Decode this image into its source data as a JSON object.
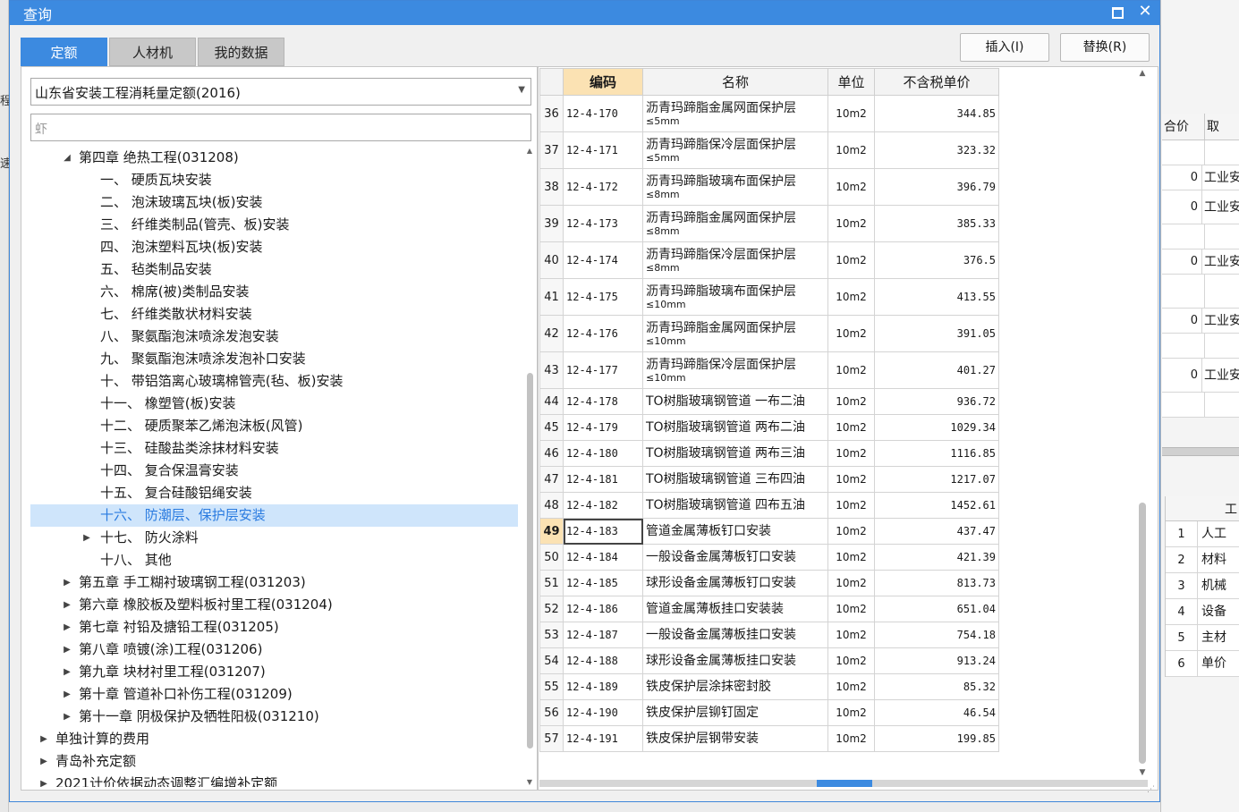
{
  "dialog": {
    "title": "查询"
  },
  "tabs": [
    "定额",
    "人材机",
    "我的数据"
  ],
  "actions": {
    "insert": "插入(I)",
    "replace": "替换(R)"
  },
  "library_select": "山东省安装工程消耗量定额(2016)",
  "search_placeholder": "虾",
  "tree": [
    {
      "label": "第四章 绝热工程(031208)",
      "level": 1,
      "toggle": "down",
      "selected": false
    },
    {
      "label": "一、  硬质瓦块安装",
      "level": 2,
      "toggle": "",
      "selected": false
    },
    {
      "label": "二、  泡沫玻璃瓦块(板)安装",
      "level": 2,
      "toggle": "",
      "selected": false
    },
    {
      "label": "三、  纤维类制品(管壳、板)安装",
      "level": 2,
      "toggle": "",
      "selected": false
    },
    {
      "label": "四、  泡沫塑料瓦块(板)安装",
      "level": 2,
      "toggle": "",
      "selected": false
    },
    {
      "label": "五、  毡类制品安装",
      "level": 2,
      "toggle": "",
      "selected": false
    },
    {
      "label": "六、  棉席(被)类制品安装",
      "level": 2,
      "toggle": "",
      "selected": false
    },
    {
      "label": "七、  纤维类散状材料安装",
      "level": 2,
      "toggle": "",
      "selected": false
    },
    {
      "label": "八、  聚氨酯泡沫喷涂发泡安装",
      "level": 2,
      "toggle": "",
      "selected": false
    },
    {
      "label": "九、  聚氨酯泡沫喷涂发泡补口安装",
      "level": 2,
      "toggle": "",
      "selected": false
    },
    {
      "label": "十、  带铝箔离心玻璃棉管壳(毡、板)安装",
      "level": 2,
      "toggle": "",
      "selected": false
    },
    {
      "label": "十一、  橡塑管(板)安装",
      "level": 2,
      "toggle": "",
      "selected": false
    },
    {
      "label": "十二、  硬质聚苯乙烯泡沫板(风管)",
      "level": 2,
      "toggle": "",
      "selected": false
    },
    {
      "label": "十三、  硅酸盐类涂抹材料安装",
      "level": 2,
      "toggle": "",
      "selected": false
    },
    {
      "label": "十四、  复合保温膏安装",
      "level": 2,
      "toggle": "",
      "selected": false
    },
    {
      "label": "十五、  复合硅酸铝绳安装",
      "level": 2,
      "toggle": "",
      "selected": false
    },
    {
      "label": "十六、  防潮层、保护层安装",
      "level": 2,
      "toggle": "",
      "selected": true
    },
    {
      "label": "十七、  防火涂料",
      "level": 2,
      "toggle": "right",
      "selected": false
    },
    {
      "label": "十八、  其他",
      "level": 2,
      "toggle": "",
      "selected": false
    },
    {
      "label": "第五章 手工糊衬玻璃钢工程(031203)",
      "level": 1,
      "toggle": "right",
      "selected": false
    },
    {
      "label": "第六章 橡胶板及塑料板衬里工程(031204)",
      "level": 1,
      "toggle": "right",
      "selected": false
    },
    {
      "label": "第七章 衬铅及搪铅工程(031205)",
      "level": 1,
      "toggle": "right",
      "selected": false
    },
    {
      "label": "第八章 喷镀(涂)工程(031206)",
      "level": 1,
      "toggle": "right",
      "selected": false
    },
    {
      "label": "第九章 块材衬里工程(031207)",
      "level": 1,
      "toggle": "right",
      "selected": false
    },
    {
      "label": "第十章 管道补口补伤工程(031209)",
      "level": 1,
      "toggle": "right",
      "selected": false
    },
    {
      "label": "第十一章 阴极保护及牺牲阳极(031210)",
      "level": 1,
      "toggle": "right",
      "selected": false
    },
    {
      "label": "单独计算的费用",
      "level": 0,
      "toggle": "right",
      "selected": false
    },
    {
      "label": "青岛补充定额",
      "level": 0,
      "toggle": "right",
      "selected": false
    },
    {
      "label": "2021计价依据动态调整汇编增补定额",
      "level": 0,
      "toggle": "right",
      "selected": false
    }
  ],
  "grid": {
    "headers": [
      "编码",
      "名称",
      "单位",
      "不含税单价"
    ],
    "current_row": "49",
    "rows": [
      {
        "no": "36",
        "code": "12-4-170",
        "name": "沥青玛蹄脂金属网面保护层",
        "sub": "≤5mm",
        "unit": "10m2",
        "price": "344.85"
      },
      {
        "no": "37",
        "code": "12-4-171",
        "name": "沥青玛蹄脂保冷层面保护层",
        "sub": "≤5mm",
        "unit": "10m2",
        "price": "323.32"
      },
      {
        "no": "38",
        "code": "12-4-172",
        "name": "沥青玛蹄脂玻璃布面保护层",
        "sub": "≤8mm",
        "unit": "10m2",
        "price": "396.79"
      },
      {
        "no": "39",
        "code": "12-4-173",
        "name": "沥青玛蹄脂金属网面保护层",
        "sub": "≤8mm",
        "unit": "10m2",
        "price": "385.33"
      },
      {
        "no": "40",
        "code": "12-4-174",
        "name": "沥青玛蹄脂保冷层面保护层",
        "sub": "≤8mm",
        "unit": "10m2",
        "price": "376.5"
      },
      {
        "no": "41",
        "code": "12-4-175",
        "name": "沥青玛蹄脂玻璃布面保护层",
        "sub": "≤10mm",
        "unit": "10m2",
        "price": "413.55"
      },
      {
        "no": "42",
        "code": "12-4-176",
        "name": "沥青玛蹄脂金属网面保护层",
        "sub": "≤10mm",
        "unit": "10m2",
        "price": "391.05"
      },
      {
        "no": "43",
        "code": "12-4-177",
        "name": "沥青玛蹄脂保冷层面保护层",
        "sub": "≤10mm",
        "unit": "10m2",
        "price": "401.27"
      },
      {
        "no": "44",
        "code": "12-4-178",
        "name": "TO树脂玻璃钢管道 一布二油",
        "sub": "",
        "unit": "10m2",
        "price": "936.72"
      },
      {
        "no": "45",
        "code": "12-4-179",
        "name": "TO树脂玻璃钢管道 两布二油",
        "sub": "",
        "unit": "10m2",
        "price": "1029.34"
      },
      {
        "no": "46",
        "code": "12-4-180",
        "name": "TO树脂玻璃钢管道 两布三油",
        "sub": "",
        "unit": "10m2",
        "price": "1116.85"
      },
      {
        "no": "47",
        "code": "12-4-181",
        "name": "TO树脂玻璃钢管道 三布四油",
        "sub": "",
        "unit": "10m2",
        "price": "1217.07"
      },
      {
        "no": "48",
        "code": "12-4-182",
        "name": "TO树脂玻璃钢管道 四布五油",
        "sub": "",
        "unit": "10m2",
        "price": "1452.61"
      },
      {
        "no": "49",
        "code": "12-4-183",
        "name": "管道金属薄板钉口安装",
        "sub": "",
        "unit": "10m2",
        "price": "437.47"
      },
      {
        "no": "50",
        "code": "12-4-184",
        "name": "一般设备金属薄板钉口安装",
        "sub": "",
        "unit": "10m2",
        "price": "421.39"
      },
      {
        "no": "51",
        "code": "12-4-185",
        "name": "球形设备金属薄板钉口安装",
        "sub": "",
        "unit": "10m2",
        "price": "813.73"
      },
      {
        "no": "52",
        "code": "12-4-186",
        "name": "管道金属薄板挂口安装装",
        "sub": "",
        "unit": "10m2",
        "price": "651.04"
      },
      {
        "no": "53",
        "code": "12-4-187",
        "name": "一般设备金属薄板挂口安装",
        "sub": "",
        "unit": "10m2",
        "price": "754.18"
      },
      {
        "no": "54",
        "code": "12-4-188",
        "name": "球形设备金属薄板挂口安装",
        "sub": "",
        "unit": "10m2",
        "price": "913.24"
      },
      {
        "no": "55",
        "code": "12-4-189",
        "name": "铁皮保护层涂抹密封胶",
        "sub": "",
        "unit": "10m2",
        "price": "85.32"
      },
      {
        "no": "56",
        "code": "12-4-190",
        "name": "铁皮保护层铆钉固定",
        "sub": "",
        "unit": "10m2",
        "price": "46.54"
      },
      {
        "no": "57",
        "code": "12-4-191",
        "name": "铁皮保护层钢带安装",
        "sub": "",
        "unit": "10m2",
        "price": "199.85"
      }
    ]
  },
  "background": {
    "left_chars": [
      "程",
      "速"
    ],
    "grid1_headers": [
      "合价",
      "取"
    ],
    "grid1_rows": [
      {
        "v": "",
        "t": ""
      },
      {
        "v": "0",
        "t": "工业安"
      },
      {
        "v": "0",
        "t": "工业安"
      },
      {
        "v": "",
        "t": ""
      },
      {
        "v": "0",
        "t": "工业安"
      },
      {
        "v": "",
        "t": ""
      },
      {
        "v": "0",
        "t": "工业安"
      },
      {
        "v": "",
        "t": ""
      },
      {
        "v": "0",
        "t": "工业安"
      },
      {
        "v": "",
        "t": ""
      }
    ],
    "grid2_header": "工",
    "grid2_rows": [
      {
        "n": "1",
        "t": "人工"
      },
      {
        "n": "2",
        "t": "材料"
      },
      {
        "n": "3",
        "t": "机械"
      },
      {
        "n": "4",
        "t": "设备"
      },
      {
        "n": "5",
        "t": "主材"
      },
      {
        "n": "6",
        "t": "单价"
      }
    ]
  }
}
